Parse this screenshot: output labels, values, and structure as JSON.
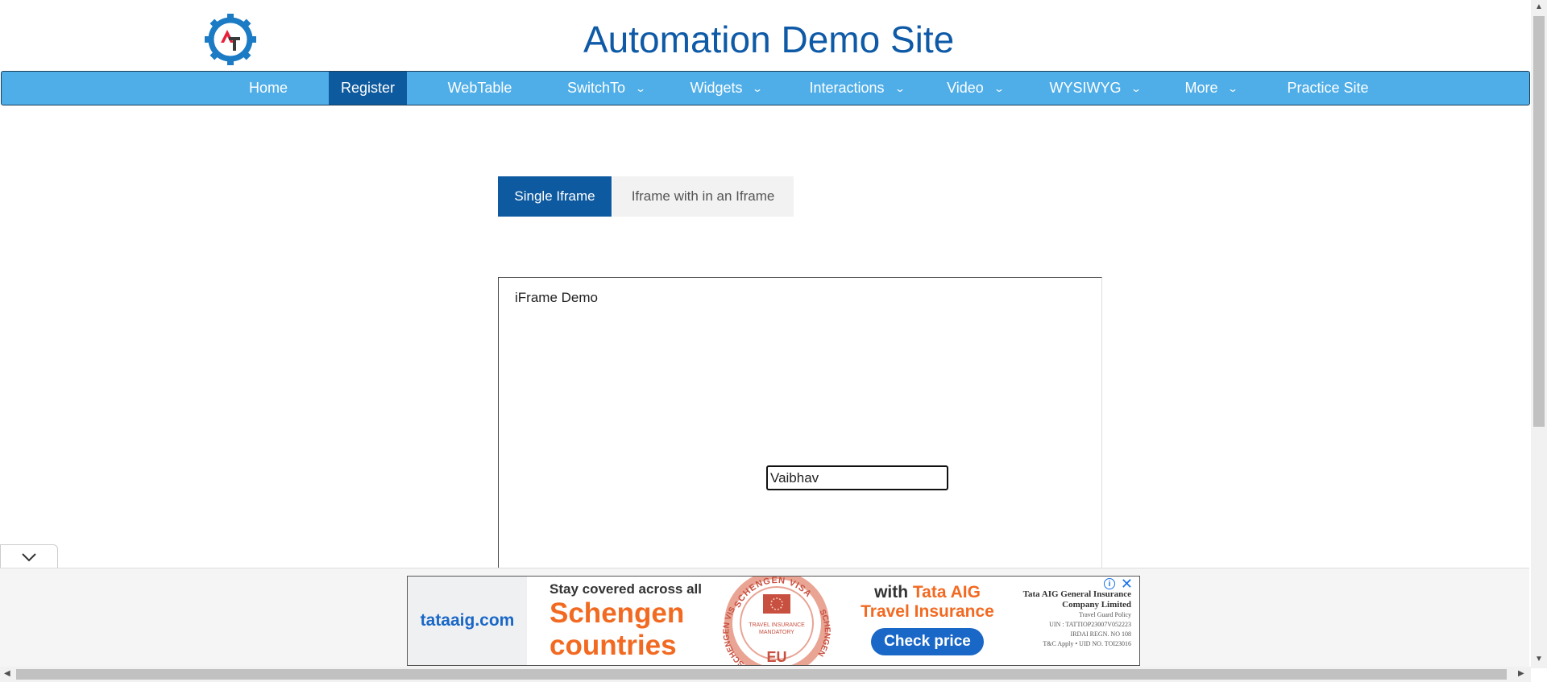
{
  "header": {
    "title": "Automation Demo Site",
    "logo_icon": "gear-logo-icon"
  },
  "nav": {
    "items": [
      {
        "label": "Home",
        "dropdown": false
      },
      {
        "label": "Register",
        "dropdown": false,
        "active": true
      },
      {
        "label": "WebTable",
        "dropdown": false
      },
      {
        "label": "SwitchTo",
        "dropdown": true
      },
      {
        "label": "Widgets",
        "dropdown": true
      },
      {
        "label": "Interactions",
        "dropdown": true
      },
      {
        "label": "Video",
        "dropdown": true
      },
      {
        "label": "WYSIWYG",
        "dropdown": true
      },
      {
        "label": "More",
        "dropdown": true
      },
      {
        "label": "Practice Site",
        "dropdown": false
      }
    ]
  },
  "tabs": [
    {
      "label": "Single Iframe",
      "active": true
    },
    {
      "label": "Iframe with in an Iframe",
      "active": false
    }
  ],
  "iframe": {
    "title": "iFrame Demo",
    "input_value": "Vaibhav"
  },
  "ad": {
    "domain": "tataaig.com",
    "line1": "Stay covered across all",
    "line2": "Schengen",
    "line3": "countries",
    "with_prefix": "with ",
    "brand": "Tata AIG",
    "product": "Travel Insurance",
    "cta": "Check price",
    "legal_company_1": "Tata AIG General Insurance",
    "legal_company_2": "Company Limited",
    "legal_policy": "Travel Guard Policy",
    "legal_uin": "UIN : TATTIOP23007V052223",
    "legal_irdai": "IRDAI REGN. NO 108",
    "legal_tc": "T&C Apply • UID NO. TOI23016",
    "stamp_top": "SCHENGEN VISA",
    "stamp_side_left": "SCHENGEN VISA",
    "stamp_side_right": "SCHENGEN",
    "stamp_mid": "TRAVEL INSURANCE",
    "stamp_mid2": "MANDATORY",
    "stamp_bottom": "EU"
  },
  "colors": {
    "brand_blue": "#0e5aa7",
    "nav_bg": "#4faee8",
    "nav_active": "#0e5a9f",
    "ad_orange": "#f26a21"
  }
}
